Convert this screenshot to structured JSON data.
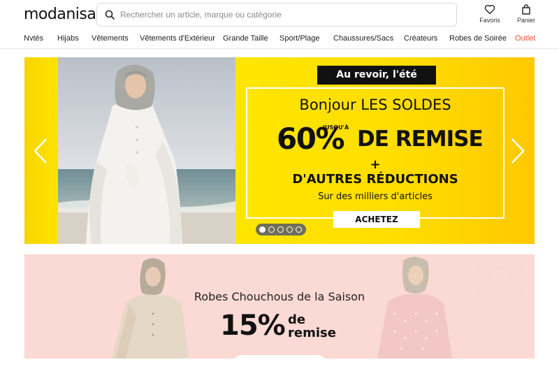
{
  "header": {
    "logo": "modanisa",
    "search_placeholder": "Rechercher un article, marque ou catégorie",
    "favorites_label": "Favoris",
    "cart_label": "Panier"
  },
  "nav": {
    "items": [
      "Nvtés",
      "Hijabs",
      "Vêtements",
      "Vêtements d'Extérieur",
      "Grande Taille",
      "Sport/Plage",
      "Chaussures/Sacs",
      "Créateurs",
      "Robes de Soirée",
      "Outlet"
    ]
  },
  "hero": {
    "tag": "Au revoir, l'été",
    "headline": "Bonjour LES SOLDES",
    "percent": "60%",
    "up_to": "JUSQU'À",
    "remise": "DE REMISE",
    "plus": "+",
    "other": "D'AUTRES RÉDUCTIONS",
    "sub": "Sur des milliers d'articles",
    "cta": "ACHETEZ",
    "slide_count": 5,
    "active_slide": 1
  },
  "promo": {
    "title": "Robes Chouchous de la Saison",
    "percent": "15%",
    "de": "de",
    "remise": "remise"
  },
  "colors": {
    "accent": "#e8542f",
    "hero_bg": "#ffe600",
    "promo_bg": "#fbd9d4"
  }
}
